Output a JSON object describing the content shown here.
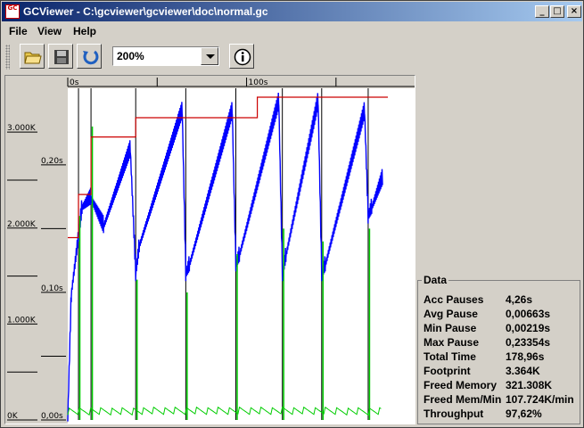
{
  "window": {
    "title": "GCViewer - C:\\gcviewer\\gcviewer\\doc\\normal.gc",
    "app_icon_text": "GC"
  },
  "menu": [
    {
      "label": "File"
    },
    {
      "label": "View"
    },
    {
      "label": "Help"
    }
  ],
  "toolbar": {
    "zoom_value": "200%"
  },
  "axes": {
    "time_ticks": [
      "0s",
      "100s"
    ],
    "memory_ticks": [
      "3.000K",
      "2.000K",
      "1.000K",
      "0K"
    ],
    "pause_ticks": [
      "0,20s",
      "0,10s",
      "0,00s"
    ]
  },
  "data_panel": {
    "title": "Data",
    "rows": [
      {
        "label": "Acc Pauses",
        "value": "4,26s"
      },
      {
        "label": "Avg Pause",
        "value": "0,00663s"
      },
      {
        "label": "Min Pause",
        "value": "0,00219s"
      },
      {
        "label": "Max Pause",
        "value": "0,23354s"
      },
      {
        "label": "Total Time",
        "value": "178,96s"
      },
      {
        "label": "Footprint",
        "value": "3.364K"
      },
      {
        "label": "Freed Memory",
        "value": "321.308K"
      },
      {
        "label": "Freed Mem/Min",
        "value": "107.724K/min"
      },
      {
        "label": "Throughput",
        "value": "97,62%"
      }
    ]
  },
  "chart_data": {
    "type": "line",
    "x_unit": "s",
    "x_range": [
      0,
      179
    ],
    "series": [
      {
        "color": "#cc0000",
        "x": [
          0,
          6,
          6,
          13,
          13,
          38,
          38,
          106,
          106,
          179
        ],
        "y": [
          1900,
          1900,
          2350,
          2350,
          2950,
          2950,
          3150,
          3150,
          3364,
          3364
        ]
      },
      {
        "color": "#0000ff",
        "x": [
          0,
          2,
          8,
          13,
          20,
          35,
          38,
          40,
          64,
          66,
          68,
          92,
          94,
          96,
          118,
          120,
          122,
          140,
          142,
          144,
          166,
          168,
          170,
          176
        ],
        "y": [
          0,
          1300,
          2200,
          2300,
          2000,
          2800,
          1500,
          1800,
          3200,
          1500,
          1600,
          3200,
          1600,
          1700,
          3300,
          1500,
          1700,
          3300,
          1500,
          1600,
          3200,
          2100,
          2200,
          2500
        ]
      },
      {
        "color": "#00cc00",
        "peaks_x": [
          6,
          13,
          38,
          66,
          94,
          120,
          142,
          168
        ],
        "peaks_s": [
          0.16,
          0.23,
          0.11,
          0.1,
          0.13,
          0.15,
          0.14,
          0.15
        ]
      }
    ],
    "memory_axis_range": [
      0,
      3364
    ],
    "pause_axis_range": [
      0,
      0.26
    ]
  }
}
